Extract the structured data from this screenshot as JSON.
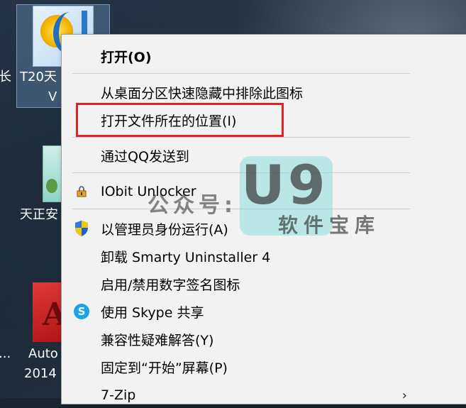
{
  "desktop": {
    "icons": [
      {
        "name": "t20-icon",
        "line1": "T20天",
        "line2": "V"
      },
      {
        "name": "tangent-doc-icon",
        "line1": "天正安",
        "line2": ""
      },
      {
        "name": "autocad-icon",
        "line1": "Auto",
        "line2": "2014"
      }
    ],
    "left_fragments": {
      "top": "长",
      "mid": "..."
    }
  },
  "context_menu": {
    "items": [
      {
        "label": "打开(O)",
        "bold": true
      },
      {
        "label": "从桌面分区快速隐藏中排除此图标"
      },
      {
        "label": "打开文件所在的位置(I)",
        "highlighted": true
      },
      {
        "label": "通过QQ发送到"
      },
      {
        "label": "IObit Unlocker",
        "icon": "lock-icon"
      },
      {
        "label": "以管理员身份运行(A)",
        "icon": "shield-icon"
      },
      {
        "label": "卸载 Smarty Uninstaller 4"
      },
      {
        "label": "启用/禁用数字签名图标"
      },
      {
        "label": "使用 Skype 共享",
        "icon": "skype-icon"
      },
      {
        "label": "兼容性疑难解答(Y)"
      },
      {
        "label": "固定到“开始”屏幕(P)"
      },
      {
        "label": "7-Zip",
        "submenu": true
      }
    ]
  },
  "watermark": {
    "prefix": "公众号:",
    "brand": "U9",
    "tagline": "软件宝库"
  },
  "colors": {
    "highlight_border": "#e8201f",
    "menu_bg": "#f2f2f2",
    "watermark_box": "#78d7d7"
  }
}
